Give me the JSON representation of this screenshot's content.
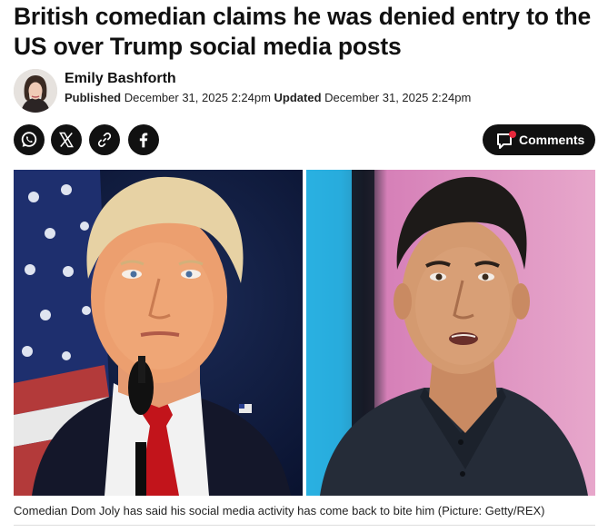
{
  "article": {
    "headline": "British comedian claims he was denied entry to the US over Trump social media posts"
  },
  "author": {
    "name": "Emily Bashforth",
    "published_label": "Published",
    "published_date": "December 31, 2025 2:24pm",
    "updated_label": "Updated",
    "updated_date": "December 31, 2025 2:24pm"
  },
  "share": {
    "icons": [
      "whatsapp-icon",
      "x-icon",
      "link-icon",
      "facebook-icon"
    ]
  },
  "comments": {
    "label": "Comments",
    "icon": "comment-bubble-icon",
    "badge_color": "#e8283c"
  },
  "image": {
    "caption": "Comedian Dom Joly has said his social media activity has come back to bite him (Picture: Getty/REX)"
  }
}
